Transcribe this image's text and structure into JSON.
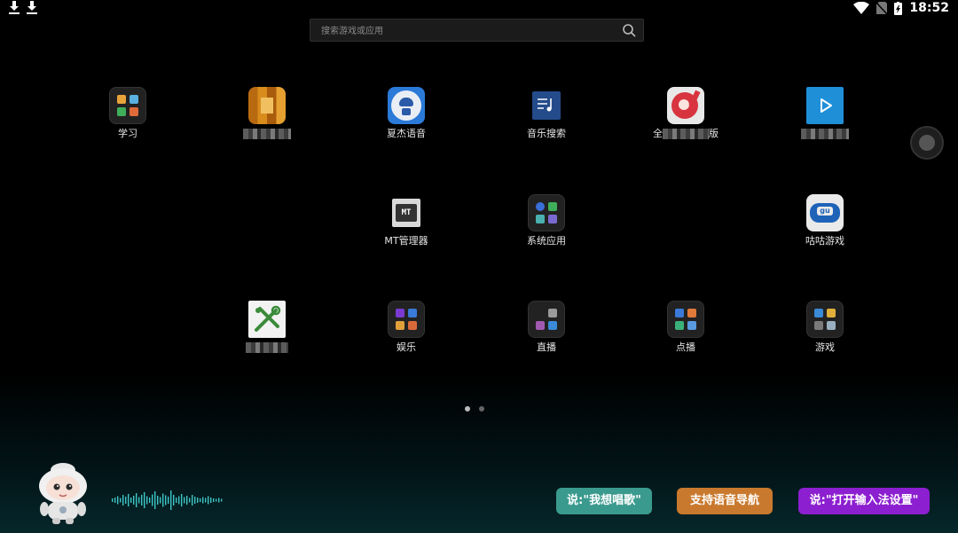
{
  "status_bar": {
    "time": "18:52",
    "left_icons": [
      "download-icon",
      "download-icon"
    ],
    "right_icons": [
      "wifi-icon",
      "no-sim-icon",
      "battery-charging-icon"
    ]
  },
  "search": {
    "placeholder": "搜索游戏或应用"
  },
  "apps": [
    {
      "label": "学习",
      "icon": "folder-icon"
    },
    {
      "label": "",
      "icon": "orange-app-icon",
      "label_obscured": true
    },
    {
      "label": "夏杰语音",
      "icon": "voice-assistant-icon"
    },
    {
      "label": "音乐搜索",
      "icon": "music-search-icon"
    },
    {
      "label": "全",
      "label_suffix": "版",
      "icon": "music-app-icon",
      "label_obscured": true
    },
    {
      "label": "",
      "icon": "video-player-icon",
      "label_obscured": true
    },
    {
      "label": "MT管理器",
      "icon": "mt-manager-icon"
    },
    {
      "label": "系统应用",
      "icon": "folder-icon"
    },
    {
      "label": "咕咕游戏",
      "icon": "gamepad-icon"
    },
    {
      "label": "",
      "icon": "tools-icon",
      "label_obscured": true
    },
    {
      "label": "娱乐",
      "icon": "folder-icon"
    },
    {
      "label": "直播",
      "icon": "folder-icon"
    },
    {
      "label": "点播",
      "icon": "folder-icon"
    },
    {
      "label": "游戏",
      "icon": "folder-icon"
    }
  ],
  "page_indicator": {
    "pages": 2,
    "current": 1
  },
  "voice_bar": {
    "hints": [
      {
        "label": "说:\"我想唱歌\"",
        "color": "#3a9a8e"
      },
      {
        "label": "支持语音导航",
        "color": "#c9792d"
      },
      {
        "label": "说:\"打开输入法设置\"",
        "color": "#8c1fd0"
      }
    ]
  }
}
